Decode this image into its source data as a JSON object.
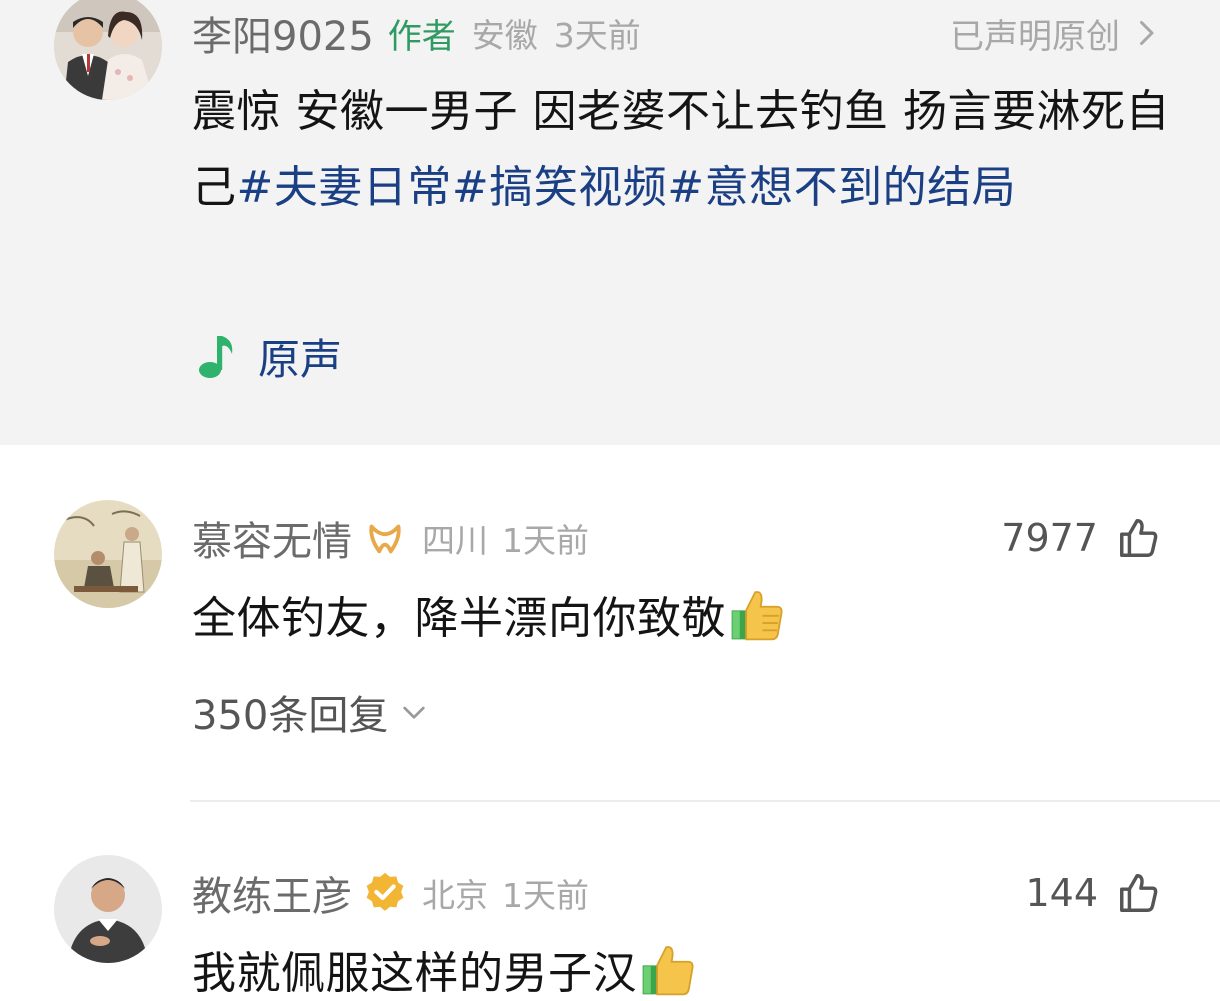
{
  "author_post": {
    "author_name": "李阳9025",
    "author_tag": "作者",
    "location": "安徽",
    "time": "3天前",
    "original_label": "已声明原创",
    "text": "震惊 安徽一男子 因老婆不让去钓鱼 扬言要淋死自己",
    "hashtags": [
      "#夫妻日常",
      "#搞笑视频",
      "#意想不到的结局"
    ],
    "sound_label": "原声"
  },
  "comments": [
    {
      "user": "慕容无情",
      "location": "四川",
      "time": "1天前",
      "likes": "7977",
      "text": "全体钓友，降半漂向你致敬",
      "replies_label": "350条回复"
    },
    {
      "user": "教练王彦",
      "location": "北京",
      "time": "1天前",
      "likes": "144",
      "text": "我就佩服这样的男子汉"
    }
  ],
  "colors": {
    "hashtag": "#1a3f84",
    "author_tag": "#2f9b63",
    "meta": "#a8a8a8",
    "pinned_bg": "#f3f3f3"
  }
}
